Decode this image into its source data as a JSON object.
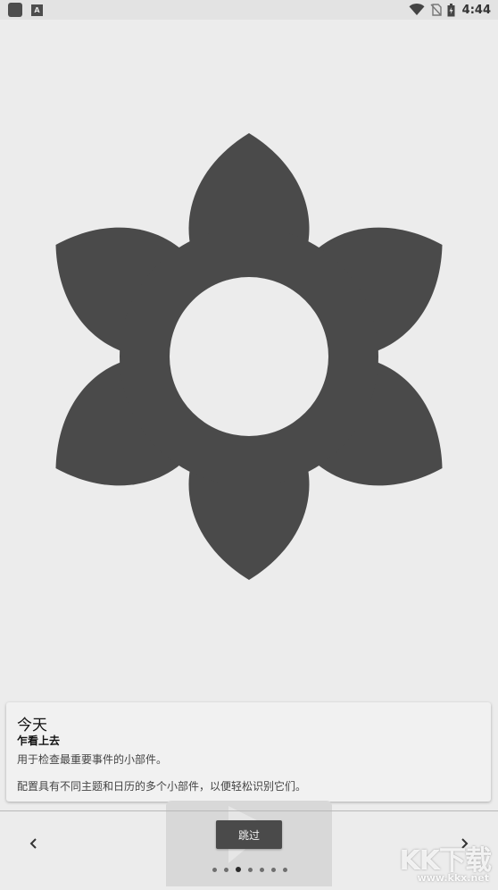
{
  "status_bar": {
    "time": "4:44",
    "left_icons": [
      "app-icon",
      "a-icon"
    ],
    "right_icons": [
      "wifi-icon",
      "no-sim-icon",
      "battery-icon"
    ],
    "a_icon_letter": "A"
  },
  "illustration": {
    "icon": "flower-icon",
    "petal_count": 6,
    "color": "#4a4a4a",
    "center_color": "#ececec"
  },
  "card": {
    "title": "今天",
    "subtitle": "乍看上去",
    "line1": "用于检查最重要事件的小部件。",
    "line2": "配置具有不同主题和日历的多个小部件，以便轻松识别它们。"
  },
  "navigation": {
    "skip_label": "跳过",
    "page_count": 7,
    "active_page": 3
  },
  "watermark": {
    "main": "KK下载",
    "sub": "www.kkx.net"
  }
}
